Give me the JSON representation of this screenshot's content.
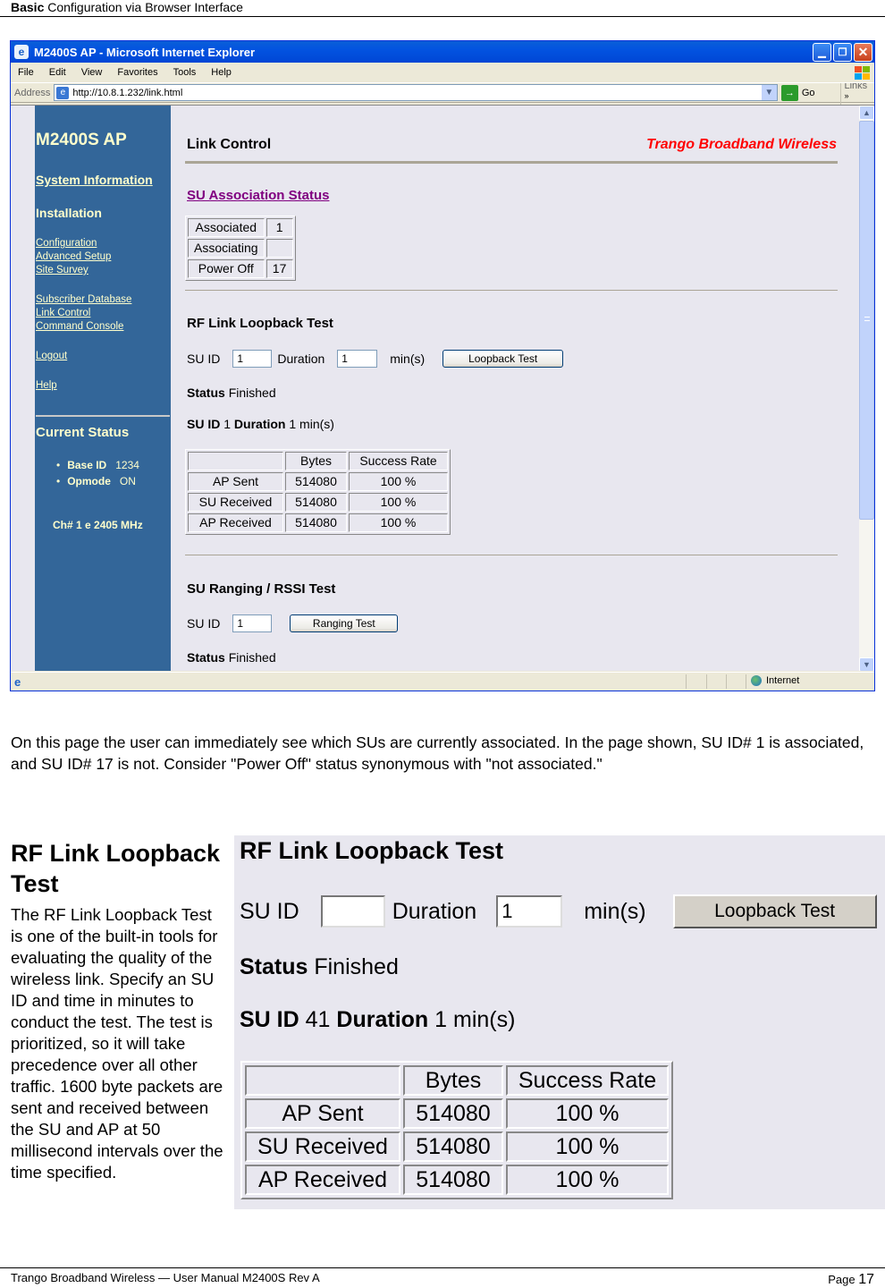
{
  "doc": {
    "header_bold": "Basic",
    "header_rest": " Configuration via Browser Interface",
    "footer_left": "Trango Broadband Wireless — User Manual M2400S Rev A",
    "footer_page_label": "Page ",
    "footer_page_num": "17"
  },
  "browser": {
    "title": "M2400S AP - Microsoft Internet Explorer",
    "menu": [
      "File",
      "Edit",
      "View",
      "Favorites",
      "Tools",
      "Help"
    ],
    "address_label": "Address",
    "url": "http://10.8.1.232/link.html",
    "go_label": "Go",
    "links_label": "Links",
    "status_zone": "Internet"
  },
  "sidebar": {
    "brand": "M2400S AP",
    "system_information": "System Information",
    "installation": "Installation",
    "links": [
      {
        "label": "Configuration"
      },
      {
        "label": "Advanced Setup"
      },
      {
        "label": "Site Survey"
      },
      {
        "label": "Subscriber Database"
      },
      {
        "label": "Link Control"
      },
      {
        "label": "Command Console"
      },
      {
        "label": "Logout"
      },
      {
        "label": "Help"
      }
    ],
    "current_status_title": "Current Status",
    "status_items": [
      {
        "label": "Base ID",
        "value": "1234"
      },
      {
        "label": "Opmode",
        "value": "ON"
      }
    ],
    "channel": "Ch# 1 e 2405 MHz"
  },
  "content": {
    "page_title": "Link Control",
    "brand": "Trango Broadband Wireless",
    "assoc": {
      "title": "SU Association Status",
      "rows": [
        {
          "label": "Associated",
          "value": "1"
        },
        {
          "label": "Associating",
          "value": ""
        },
        {
          "label": "Power Off",
          "value": "17"
        }
      ]
    },
    "loopback": {
      "title": "RF Link Loopback Test",
      "su_id_label": "SU ID",
      "su_id_value": "1",
      "duration_label": "Duration",
      "duration_value": "1",
      "unit": "min(s)",
      "button": "Loopback Test",
      "status_label": "Status",
      "status_value": "Finished",
      "result_su_label": "SU ID",
      "result_su_value": "1",
      "result_duration_label": "Duration",
      "result_duration_value": "1 min(s)",
      "table_headers": [
        "",
        "Bytes",
        "Success Rate"
      ],
      "table_rows": [
        [
          "AP Sent",
          "514080",
          "100 %"
        ],
        [
          "SU Received",
          "514080",
          "100 %"
        ],
        [
          "AP Received",
          "514080",
          "100 %"
        ]
      ]
    },
    "ranging": {
      "title": "SU Ranging / RSSI Test",
      "su_id_label": "SU ID",
      "su_id_value": "1",
      "button": "Ranging Test",
      "status_label": "Status",
      "status_value": "Finished"
    }
  },
  "body_text": {
    "paragraph": "On this page the user can immediately see which SUs are currently associated. In the page shown, SU ID# 1 is associated, and SU ID# 17 is not.  Consider \"Power Off\" status synonymous with \"not associated.\"",
    "side_heading": "RF Link Loopback Test",
    "side_body": "The RF Link Loopback Test is one of the built-in tools for evaluating the quality of the wireless link. Specify an SU ID and time in minutes to conduct the test. The test is prioritized, so it will take precedence over all other traffic. 1600 byte packets are sent and received between the SU and AP at 50 millisecond intervals over the time specified."
  },
  "inset": {
    "title": "RF Link Loopback Test",
    "su_id_label": "SU ID",
    "su_id_value": "",
    "duration_label": "Duration",
    "duration_value": "1",
    "unit": "min(s)",
    "button": "Loopback Test",
    "status_label": "Status",
    "status_value": "Finished",
    "result_su_label": "SU ID",
    "result_su_value": "41",
    "result_duration_label": "Duration",
    "result_duration_value": "1 min(s)",
    "table_headers": [
      "",
      "Bytes",
      "Success Rate"
    ],
    "table_rows": [
      [
        "AP Sent",
        "514080",
        "100 %"
      ],
      [
        "SU Received",
        "514080",
        "100 %"
      ],
      [
        "AP Received",
        "514080",
        "100 %"
      ]
    ]
  }
}
